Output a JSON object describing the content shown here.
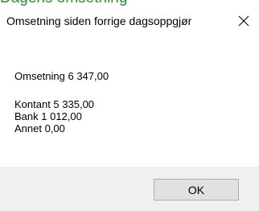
{
  "background_window": {
    "title": "Dagens omsetning",
    "title_color": "#2e8b2e"
  },
  "dialog": {
    "title": "Omsetning siden forrige dagsoppgjør",
    "close_icon": "close-icon",
    "revenue_line": "Omsetning 6 347,00",
    "breakdown": {
      "cash": "Kontant 5 335,00",
      "bank": "Bank 1 012,00",
      "other": "Annet 0,00"
    },
    "ok_label": "OK"
  }
}
